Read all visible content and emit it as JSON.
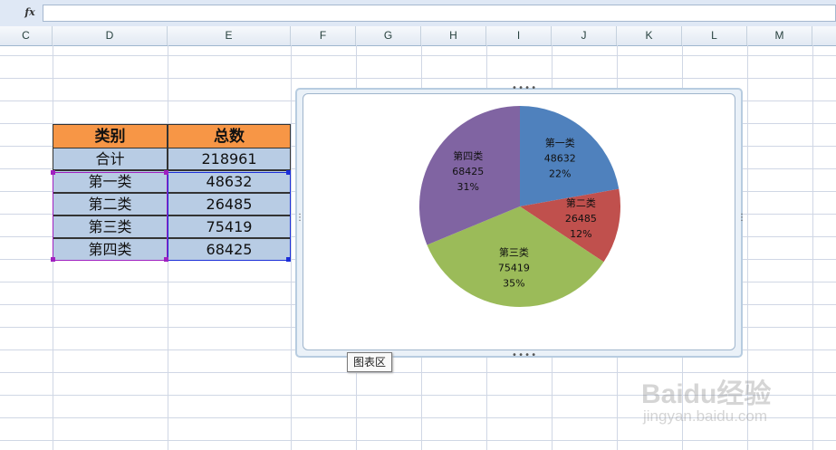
{
  "formula_bar": {
    "fx_label": "fx",
    "value": ""
  },
  "columns": [
    "C",
    "D",
    "E",
    "F",
    "G",
    "H",
    "I",
    "J",
    "K",
    "L",
    "M"
  ],
  "table": {
    "headers": [
      "类别",
      "总数"
    ],
    "rows": [
      [
        "合计",
        "218961"
      ],
      [
        "第一类",
        "48632"
      ],
      [
        "第二类",
        "26485"
      ],
      [
        "第三类",
        "75419"
      ],
      [
        "第四类",
        "68425"
      ]
    ]
  },
  "chart_data": {
    "type": "pie",
    "categories": [
      "第一类",
      "第二类",
      "第三类",
      "第四类"
    ],
    "values": [
      48632,
      26485,
      75419,
      68425
    ],
    "percent_labels": [
      "22%",
      "12%",
      "35%",
      "31%"
    ],
    "colors": [
      "#4f81bd",
      "#c0504d",
      "#9bbb59",
      "#8064a2"
    ],
    "legend": "none"
  },
  "tooltip": "图表区",
  "watermark": {
    "main": "Baidu经验",
    "sub": "jingyan.baidu.com"
  }
}
